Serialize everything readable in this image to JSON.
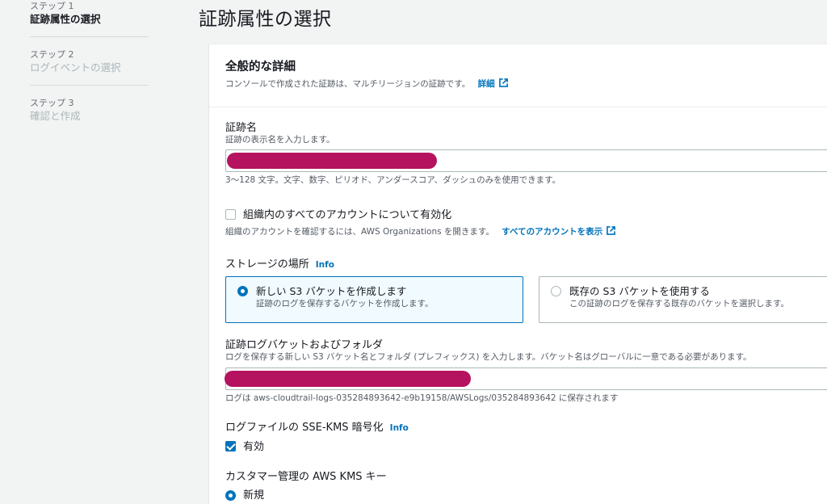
{
  "steps": [
    {
      "number": "ステップ 1",
      "title": "証跡属性の選択"
    },
    {
      "number": "ステップ 2",
      "title": "ログイベントの選択"
    },
    {
      "number": "ステップ 3",
      "title": "確認と作成"
    }
  ],
  "page_title": "証跡属性の選択",
  "panel": {
    "title": "全般的な詳細",
    "description": "コンソールで作成された証跡は、マルチリージョンの証跡です。",
    "details_link": "詳細"
  },
  "trail_name": {
    "label": "証跡名",
    "description": "証跡の表示名を入力します。",
    "hint": "3～128 文字。文字、数字、ピリオド、アンダースコア、ダッシュのみを使用できます。"
  },
  "org": {
    "label": "組織内のすべてのアカウントについて有効化",
    "description": "組織のアカウントを確認するには、AWS Organizations を開きます。",
    "link": "すべてのアカウントを表示"
  },
  "storage": {
    "label": "ストレージの場所",
    "info": "Info",
    "option_new_label": "新しい S3 バケットを作成します",
    "option_new_desc": "証跡のログを保存するバケットを作成します。",
    "option_existing_label": "既存の S3 バケットを使用する",
    "option_existing_desc": "この証跡のログを保存する既存のバケットを選択します。"
  },
  "bucket": {
    "label": "証跡ログバケットおよびフォルダ",
    "description": "ログを保存する新しい S3 バケット名とフォルダ (プレフィックス) を入力します。バケット名はグローバルに一意である必要があります。",
    "hint": "ログは aws-cloudtrail-logs-035284893642-e9b19158/AWSLogs/035284893642 に保存されます"
  },
  "sse": {
    "label": "ログファイルの SSE-KMS 暗号化",
    "info": "Info",
    "checkbox_label": "有効"
  },
  "kms": {
    "label": "カスタマー管理の AWS KMS キー",
    "option_new": "新規"
  },
  "colors": {
    "accent": "#0073bb",
    "redaction": "#b5125f"
  }
}
